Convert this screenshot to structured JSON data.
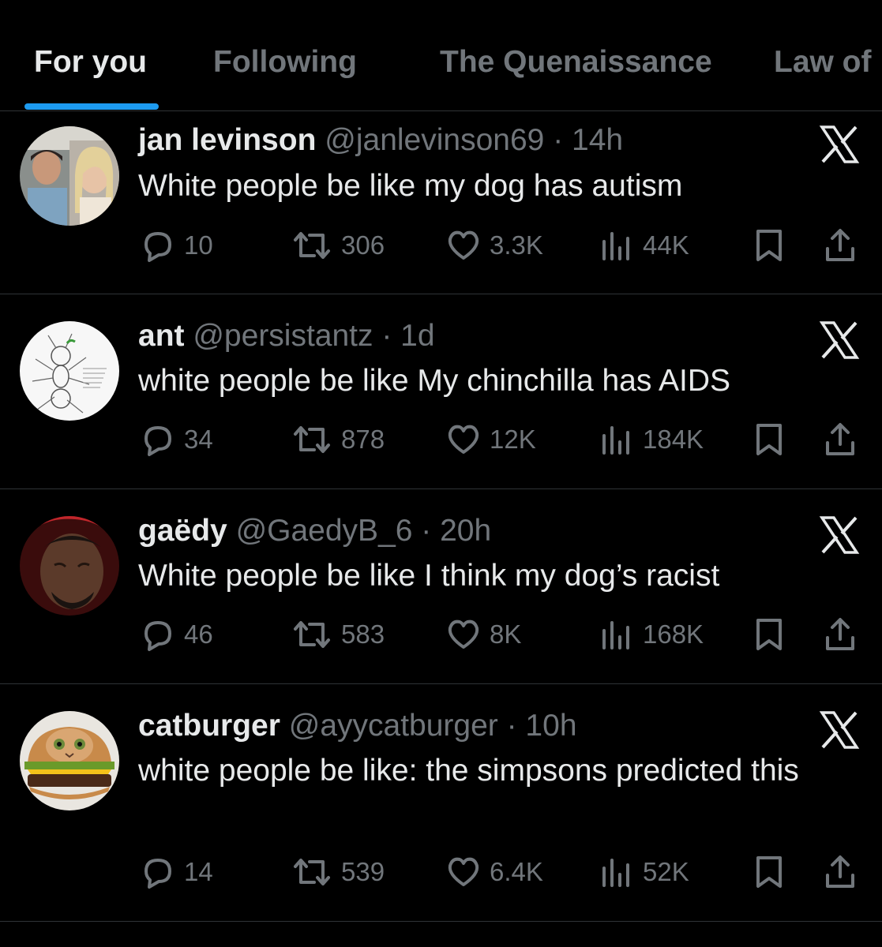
{
  "tabs": [
    "For you",
    "Following",
    "The Quenaissance",
    "Law of"
  ],
  "accent_color": "#1d9bf0",
  "posts": [
    {
      "name": "jan levinson",
      "meta": "@janlevinson69 · 14h",
      "text": "White people be like my dog has autism",
      "replies": "10",
      "reposts": "306",
      "likes": "3.3K",
      "views": "44K"
    },
    {
      "name": "ant",
      "meta": "@persistantz · 1d",
      "text": "white people be like My chinchilla has AIDS",
      "replies": "34",
      "reposts": "878",
      "likes": "12K",
      "views": "184K"
    },
    {
      "name": "gaëdy",
      "meta": "@GaedyB_6 · 20h",
      "text": "White people be like I think my dog’s racist",
      "replies": "46",
      "reposts": "583",
      "likes": "8K",
      "views": "168K"
    },
    {
      "name": "catburger",
      "meta": "@ayycatburger · 10h",
      "text": "white people be like: the simpsons predicted this",
      "replies": "14",
      "reposts": "539",
      "likes": "6.4K",
      "views": "52K"
    }
  ],
  "icons": {
    "reply": "speech-bubble-icon",
    "repost": "repost-arrows-icon",
    "like": "heart-icon",
    "views": "bar-chart-icon",
    "bookmark": "bookmark-icon",
    "share": "share-upload-icon",
    "brand": "x-logo-icon"
  }
}
